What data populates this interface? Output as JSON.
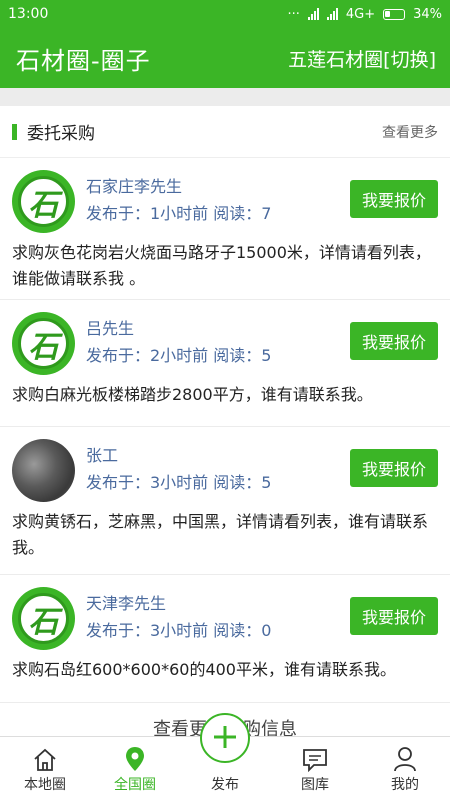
{
  "status": {
    "time": "13:00",
    "network": "4G+",
    "battery": "34%"
  },
  "header": {
    "title": "石材圈-圈子",
    "switch": "五莲石材圈[切换]"
  },
  "section": {
    "title": "委托采购",
    "more": "查看更多"
  },
  "posts": [
    {
      "name": "石家庄李先生",
      "meta": "发布于：1小时前   阅读：7",
      "button": "我要报价",
      "text": "求购灰色花岗岩火烧面马路牙子15000米，详情请看列表，谁能做请联系我 。",
      "avatar": "stone-logo"
    },
    {
      "name": "吕先生",
      "meta": "发布于：2小时前   阅读：5",
      "button": "我要报价",
      "text": "求购白麻光板楼梯踏步2800平方，谁有请联系我。",
      "avatar": "stone-logo"
    },
    {
      "name": "张工",
      "meta": "发布于：3小时前   阅读：5",
      "button": "我要报价",
      "text": "求购黄锈石，芝麻黑，中国黑，详情请看列表，谁有请联系我。",
      "avatar": "photo"
    },
    {
      "name": "天津李先生",
      "meta": "发布于：3小时前   阅读：0",
      "button": "我要报价",
      "text": "求购石岛红600*600*60的400平米，谁有请联系我。",
      "avatar": "stone-logo"
    }
  ],
  "more_link": "查看更多采购信息",
  "logo_char": "石",
  "nav": {
    "local": "本地圈",
    "national": "全国圈",
    "publish": "发布",
    "gallery": "图库",
    "mine": "我的"
  },
  "colors": {
    "primary": "#3bb526",
    "name_text": "#4a6a9e"
  }
}
